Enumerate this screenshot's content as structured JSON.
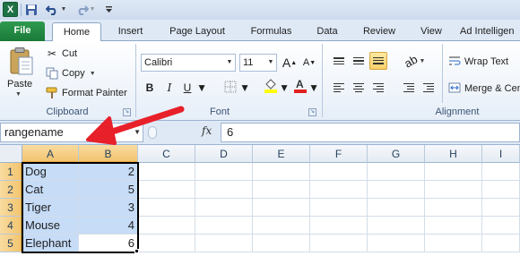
{
  "qat": {
    "app_icon_label": "X",
    "icons": [
      "save-icon",
      "undo-icon",
      "redo-icon",
      "customize-icon"
    ]
  },
  "tabs": {
    "file": "File",
    "home": "Home",
    "insert": "Insert",
    "page_layout": "Page Layout",
    "formulas": "Formulas",
    "data": "Data",
    "review": "Review",
    "view": "View",
    "addin": "Ad Intelligen"
  },
  "clipboard": {
    "paste": "Paste",
    "cut": "Cut",
    "copy": "Copy",
    "format_painter": "Format Painter",
    "group_label": "Clipboard"
  },
  "font": {
    "name": "Calibri",
    "size": "11",
    "bold": "B",
    "italic": "I",
    "underline": "U",
    "grow": "A",
    "shrink": "A",
    "group_label": "Font",
    "font_color": "#e02020",
    "fill_color": "#ffff00"
  },
  "alignment": {
    "wrap_text": "Wrap Text",
    "merge_center": "Merge & Center",
    "group_label": "Alignment"
  },
  "formula_bar": {
    "name_box": "rangename",
    "fx": "fx",
    "value": "6"
  },
  "grid": {
    "columns": [
      "A",
      "B",
      "C",
      "D",
      "E",
      "F",
      "G",
      "H",
      "I"
    ],
    "rows": [
      "1",
      "2",
      "3",
      "4",
      "5"
    ],
    "cells": [
      {
        "a": "Dog",
        "b": "2"
      },
      {
        "a": "Cat",
        "b": "5"
      },
      {
        "a": "Tiger",
        "b": "3"
      },
      {
        "a": "Mouse",
        "b": "4"
      },
      {
        "a": "Elephant",
        "b": "6"
      }
    ]
  },
  "colors": {
    "selection_fill": "#c6dcf7",
    "annotation_arrow": "#e8202a",
    "file_tab": "#1f8a44"
  }
}
